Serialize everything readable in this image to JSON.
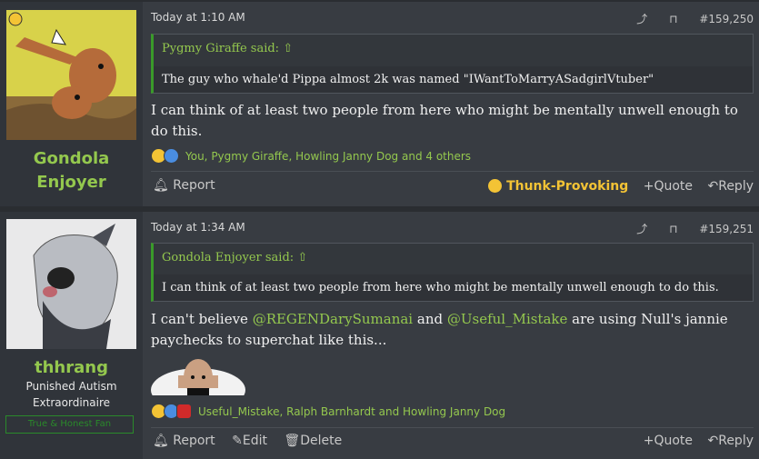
{
  "posts": [
    {
      "username_line1": "Gondola",
      "username_line2": "Enjoyer",
      "date": "Today at 1:10 AM",
      "post_number": "#159,250",
      "quote_author": "Pygmy Giraffe said:",
      "quote_text": "The guy who whale'd Pippa almost 2k was named \"IWantToMarryASadgirlVtuber\"",
      "message": "I can think of at least two people from here who might be mentally unwell enough to do this.",
      "reaction_names": "You, Pygmy Giraffe, Howling Janny Dog and 4 others",
      "reaction_given": "Thunk-Provoking",
      "report_label": "Report",
      "quote_label": "Quote",
      "reply_label": "Reply"
    },
    {
      "username": "thhrang",
      "user_title_line1": "Punished Autism",
      "user_title_line2": "Extraordinaire",
      "badge": "True & Honest Fan",
      "date": "Today at 1:34 AM",
      "post_number": "#159,251",
      "quote_author": "Gondola Enjoyer said:",
      "quote_text": "I can think of at least two people from here who might be mentally unwell enough to do this.",
      "message_part1": "I can't believe ",
      "mention1": "@REGENDarySumanai",
      "message_part2": " and ",
      "mention2": "@Useful_Mistake",
      "message_part3": " are using Null's jannie paychecks to superchat like this...",
      "reaction_names": "Useful_Mistake, Ralph Barnhardt and Howling Janny Dog",
      "report_label": "Report",
      "edit_label": "Edit",
      "delete_label": "Delete",
      "quote_label": "Quote",
      "reply_label": "Reply"
    }
  ],
  "icons": [
    "share-icon",
    "bookmark-icon",
    "bell-icon",
    "plus-icon",
    "reply-icon",
    "pencil-icon",
    "trash-icon",
    "quote-arrow-icon"
  ]
}
